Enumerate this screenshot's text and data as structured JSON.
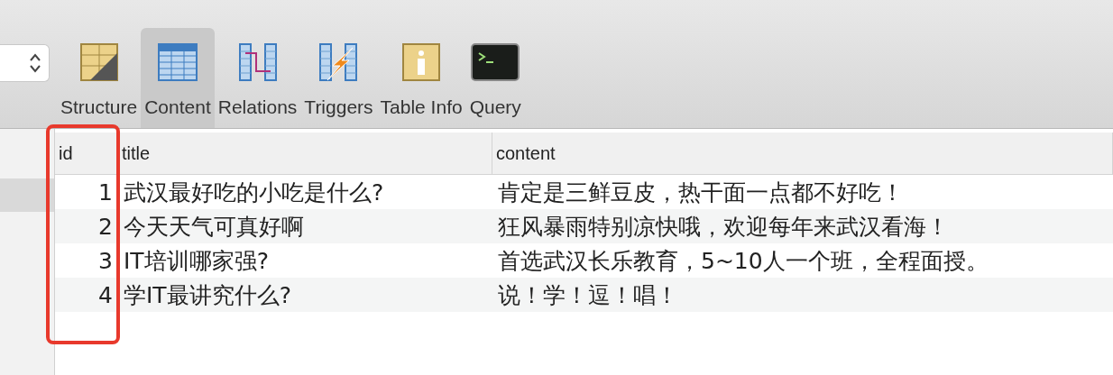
{
  "toolbar": {
    "items": [
      {
        "label": "Structure",
        "kind": "structure",
        "selected": false
      },
      {
        "label": "Content",
        "kind": "content",
        "selected": true
      },
      {
        "label": "Relations",
        "kind": "relations",
        "selected": false
      },
      {
        "label": "Triggers",
        "kind": "triggers",
        "selected": false
      },
      {
        "label": "Table Info",
        "kind": "info",
        "selected": false
      },
      {
        "label": "Query",
        "kind": "query",
        "selected": false
      }
    ]
  },
  "sidebar": {
    "rows": [
      {
        "selected": true
      }
    ]
  },
  "table": {
    "columns": [
      "id",
      "title",
      "content"
    ],
    "rows": [
      [
        "1",
        "武汉最好吃的小吃是什么?",
        "肯定是三鲜豆皮，热干面一点都不好吃！"
      ],
      [
        "2",
        "今天天气可真好啊",
        "狂风暴雨特别凉快哦，欢迎每年来武汉看海！"
      ],
      [
        "3",
        "IT培训哪家强?",
        "首选武汉长乐教育，5~10人一个班，全程面授。"
      ],
      [
        "4",
        "学IT最讲究什么?",
        "说！学！逗！唱！"
      ]
    ]
  }
}
